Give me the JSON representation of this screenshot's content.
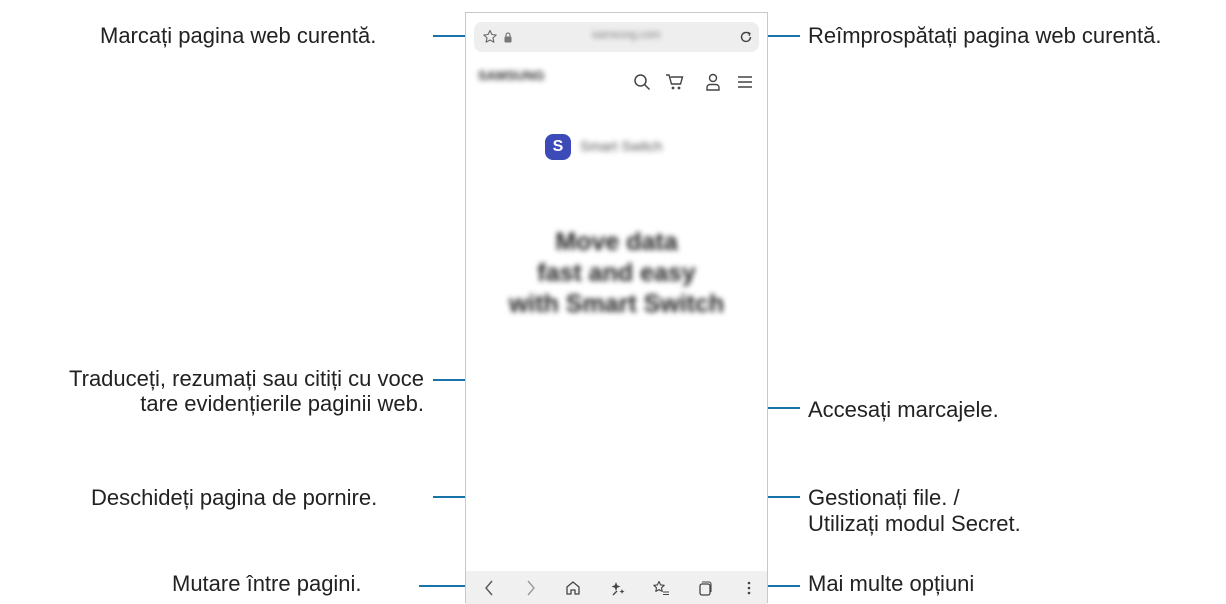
{
  "callouts": {
    "bookmark_page": "Marcați pagina web curentă.",
    "refresh_page": "Reîmprospătați pagina web curentă.",
    "translate_line1": "Traduceți, rezumați sau citiți cu voce",
    "translate_line2": "tare evidențierile paginii web.",
    "bookmarks": "Accesați marcajele.",
    "home": "Deschideți pagina de pornire.",
    "tabs_line1": "Gestionați file. /",
    "tabs_line2": "Utilizați modul Secret.",
    "move_pages": "Mutare între pagini.",
    "more_options": "Mai multe opțiuni"
  },
  "browser": {
    "url": "samsung.com",
    "site_name": "SAMSUNG",
    "app_name": "Smart Switch",
    "headline_line1": "Move data",
    "headline_line2": "fast and easy",
    "headline_line3": "with Smart Switch"
  },
  "colors": {
    "leader_line": "#1a73a8",
    "app_icon": "#3c4bb8",
    "navbar": "#f0f0f0"
  },
  "icons": [
    "star-outline-icon",
    "lock-icon",
    "refresh-icon",
    "search-icon",
    "cart-icon",
    "user-icon",
    "menu-icon",
    "back-icon",
    "forward-icon",
    "home-icon",
    "ai-tools-icon",
    "bookmarks-icon",
    "tabs-icon",
    "more-icon"
  ]
}
